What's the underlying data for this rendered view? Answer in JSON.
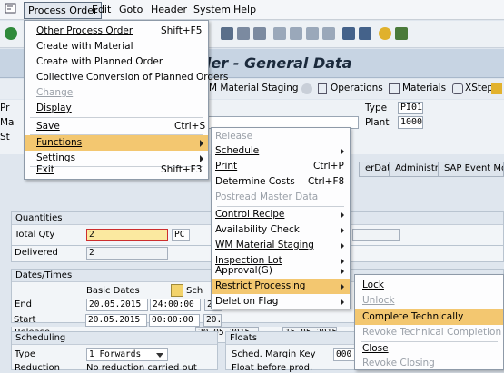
{
  "menubar": {
    "items": [
      "Process Order",
      "Edit",
      "Goto",
      "Header",
      "System",
      "Help"
    ]
  },
  "title": "der - General Data",
  "appbar": {
    "material_staging": "M Material Staging",
    "operations": "Operations",
    "materials": "Materials",
    "xsteps": "XSteps"
  },
  "header": {
    "row1_prefix": "Pr",
    "row2_prefix": "Ma",
    "row3_prefix": "St",
    "type_label": "Type",
    "type_value": "PI01",
    "plant_label": "Plant",
    "plant_value": "1000"
  },
  "tabs": [
    "erData",
    "Administr.",
    "SAP Event Mgm"
  ],
  "quantities": {
    "title": "Quantities",
    "total_label": "Total Qty",
    "total_value": "2",
    "unit": "PC",
    "delivered_label": "Delivered",
    "delivered_value": "2"
  },
  "dates": {
    "title": "Dates/Times",
    "basic_dates": "Basic Dates",
    "sch_prefix": "Sch",
    "end_label": "End",
    "end_date": "20.05.2015",
    "end_time": "24:00:00",
    "end_sched": "20.",
    "start_label": "Start",
    "start_date": "20.05.2015",
    "start_time": "00:00:00",
    "start_sched": "20.",
    "release_label": "Release",
    "release_sched": "20.05.2015",
    "release_right": "15.05.2015"
  },
  "scheduling": {
    "title": "Scheduling",
    "type_label": "Type",
    "type_value": "1 Forwards",
    "reduction_label": "Reduction",
    "reduction_value": "No reduction carried out"
  },
  "floats": {
    "title": "Floats",
    "margin_label": "Sched. Margin Key",
    "margin_value": "000",
    "float_before": "Float before prod."
  },
  "process_order_menu": {
    "items": [
      {
        "label": "Other Process Order",
        "shortcut": "Shift+F5"
      },
      {
        "label": "Create with Material",
        "shortcut": ""
      },
      {
        "label": "Create with Planned Order",
        "shortcut": ""
      },
      {
        "label": "Collective Conversion of Planned Orders",
        "shortcut": ""
      },
      {
        "label": "Change",
        "shortcut": ""
      },
      {
        "label": "Display",
        "shortcut": ""
      },
      {
        "label": "Save",
        "shortcut": "Ctrl+S"
      },
      {
        "label": "Functions",
        "shortcut": ""
      },
      {
        "label": "Settings",
        "shortcut": ""
      },
      {
        "label": "Exit",
        "shortcut": "Shift+F3"
      }
    ]
  },
  "functions_menu": {
    "items": [
      {
        "label": "Release",
        "shortcut": ""
      },
      {
        "label": "Schedule",
        "shortcut": ""
      },
      {
        "label": "Print",
        "shortcut": "Ctrl+P"
      },
      {
        "label": "Determine Costs",
        "shortcut": "Ctrl+F8"
      },
      {
        "label": "Postread Master Data",
        "shortcut": ""
      },
      {
        "label": "Control Recipe",
        "shortcut": ""
      },
      {
        "label": "Availability Check",
        "shortcut": ""
      },
      {
        "label": "WM Material Staging",
        "shortcut": ""
      },
      {
        "label": "Inspection Lot",
        "shortcut": ""
      },
      {
        "label": "Approval(G)",
        "shortcut": ""
      },
      {
        "label": "Restrict Processing",
        "shortcut": ""
      },
      {
        "label": "Deletion Flag",
        "shortcut": ""
      }
    ]
  },
  "restrict_menu": {
    "items": [
      {
        "label": "Lock"
      },
      {
        "label": "Unlock"
      },
      {
        "label": "Complete Technically"
      },
      {
        "label": "Revoke Technical Completion"
      },
      {
        "label": "Close"
      },
      {
        "label": "Revoke Closing"
      }
    ]
  },
  "colors": {
    "highlight": "#f3c770",
    "title_band": "#c7d4e3"
  }
}
